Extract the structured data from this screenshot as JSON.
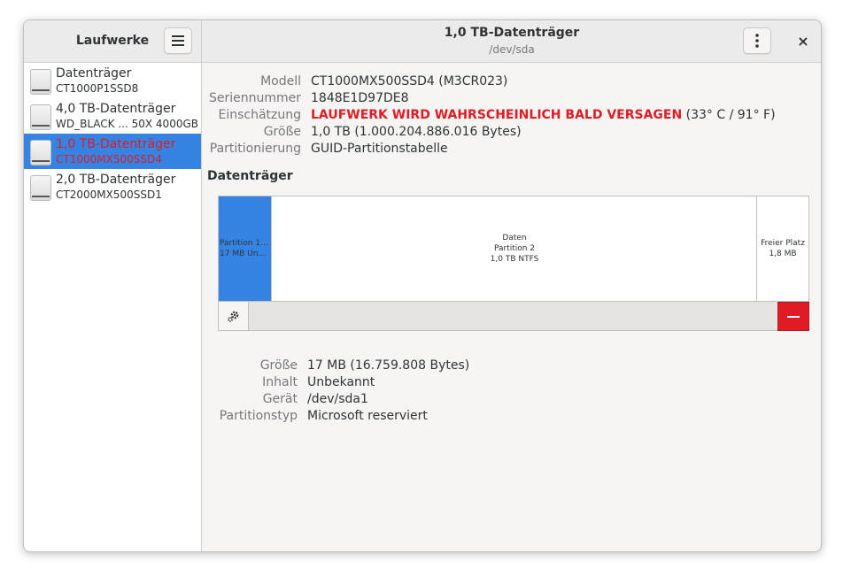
{
  "sidebar": {
    "title": "Laufwerke",
    "drives": [
      {
        "name": "Datenträger",
        "model": "CT1000P1SSD8"
      },
      {
        "name": "4,0 TB-Datenträger",
        "model": "WD_BLACK ...  50X 4000GB"
      },
      {
        "name": "1,0 TB-Datenträger",
        "model": "CT1000MX500SSD4"
      },
      {
        "name": "2,0 TB-Datenträger",
        "model": "CT2000MX500SSD1"
      }
    ],
    "selected_index": 2
  },
  "header": {
    "title": "1,0 TB-Datenträger",
    "subtitle": "/dev/sda",
    "close_label": "×"
  },
  "disk_info": {
    "model": {
      "label": "Modell",
      "value": "CT1000MX500SSD4 (M3CR023)"
    },
    "serial": {
      "label": "Seriennummer",
      "value": "1848E1D97DE8"
    },
    "assessment": {
      "label": "Einschätzung",
      "warning": "LAUFWERK WIRD WAHRSCHEINLICH BALD VERSAGEN",
      "temp": " (33° C / 91° F)"
    },
    "size": {
      "label": "Größe",
      "value": "1,0 TB (1.000.204.886.016 Bytes)"
    },
    "partitioning": {
      "label": "Partitionierung",
      "value": "GUID-Partitionstabelle"
    }
  },
  "section": {
    "title": "Datenträger"
  },
  "partitions": [
    {
      "line1": "Partition 1: ...",
      "line2": "17 MB Unbe..."
    },
    {
      "line1": "Daten",
      "line2": "Partition 2",
      "line3": "1,0 TB NTFS"
    },
    {
      "line1": "Freier Platz",
      "line2": "1,8 MB"
    }
  ],
  "partition_info": {
    "size": {
      "label": "Größe",
      "value": "17 MB (16.759.808 Bytes)"
    },
    "content": {
      "label": "Inhalt",
      "value": "Unbekannt"
    },
    "device": {
      "label": "Gerät",
      "value": "/dev/sda1"
    },
    "type": {
      "label": "Partitionstyp",
      "value": "Microsoft reserviert"
    }
  },
  "colors": {
    "accent": "#3584e4",
    "danger": "#e01b24"
  }
}
